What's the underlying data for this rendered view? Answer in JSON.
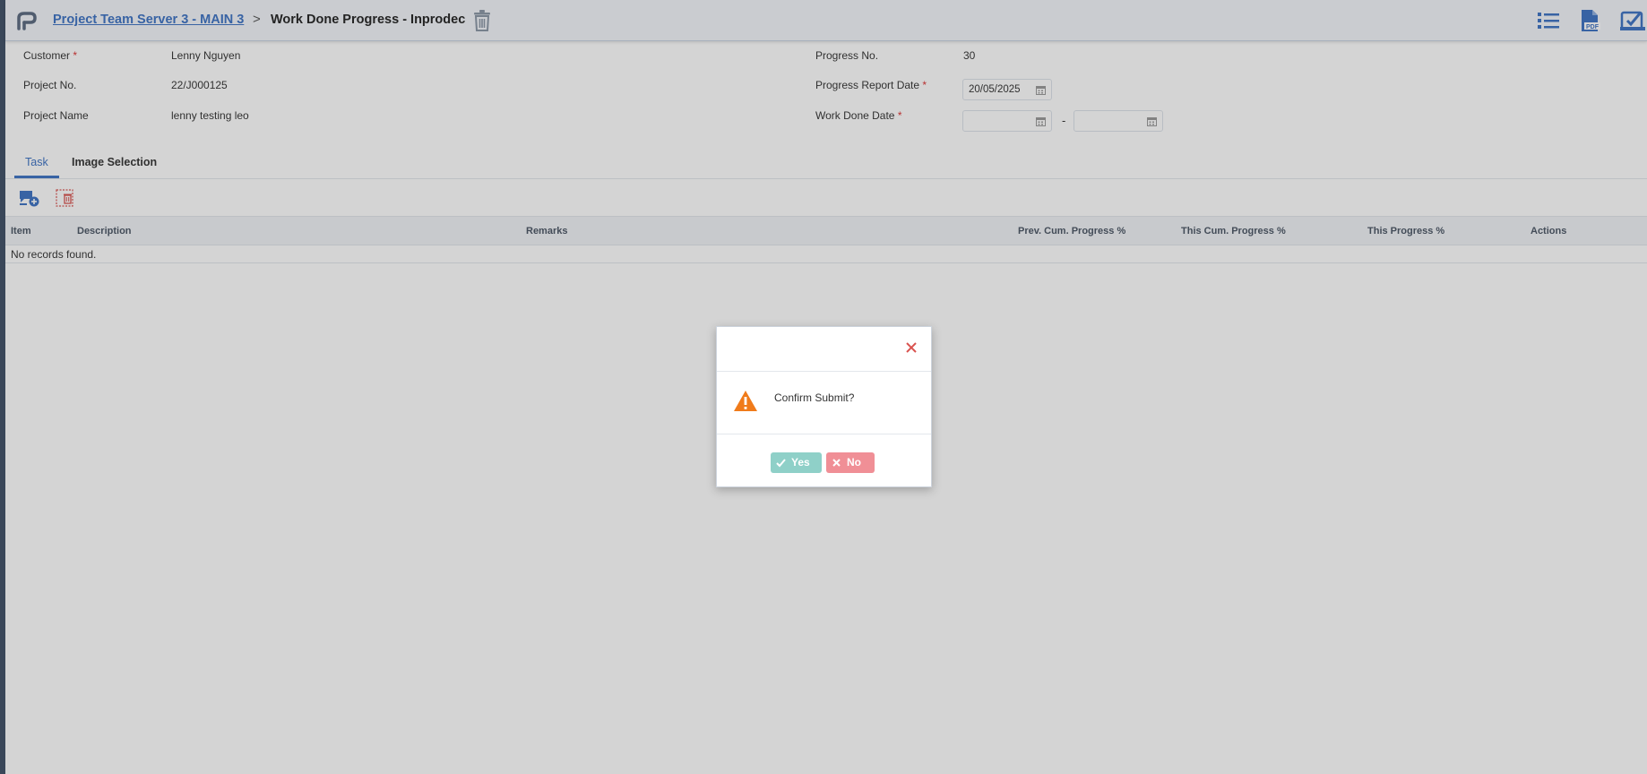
{
  "header": {
    "breadcrumb_link": "Project Team Server 3 - MAIN 3",
    "separator": ">",
    "title": "Work Done Progress - Inprodec",
    "icons": [
      "logo-icon",
      "trash-icon",
      "list-icon",
      "pdf-icon",
      "submit-check-icon"
    ]
  },
  "form": {
    "customer_label": "Customer",
    "customer_value": "Lenny Nguyen",
    "project_no_label": "Project No.",
    "project_no_value": "22/J000125",
    "project_name_label": "Project Name",
    "project_name_value": "lenny testing leo",
    "progress_no_label": "Progress No.",
    "progress_no_value": "30",
    "report_date_label": "Progress Report Date",
    "report_date_value": "20/05/2025",
    "work_done_label": "Work Done Date",
    "work_done_from": "",
    "work_done_to": "",
    "range_sep": "-",
    "required_mark": "*"
  },
  "tabs": [
    {
      "label": "Task",
      "active": true
    },
    {
      "label": "Image Selection",
      "active": false
    }
  ],
  "grid": {
    "columns": [
      "Item",
      "Description",
      "Remarks",
      "Prev. Cum. Progress %",
      "This Cum. Progress %",
      "This Progress %",
      "Actions"
    ],
    "empty_text": "No records found."
  },
  "dialog": {
    "message": "Confirm Submit?",
    "yes_label": "Yes",
    "no_label": "No"
  },
  "colors": {
    "accent": "#3d72c4",
    "warning": "#f07b1a",
    "yes_button": "#8fd0c8",
    "no_button": "#f08f96",
    "close_x": "#d9534f"
  }
}
